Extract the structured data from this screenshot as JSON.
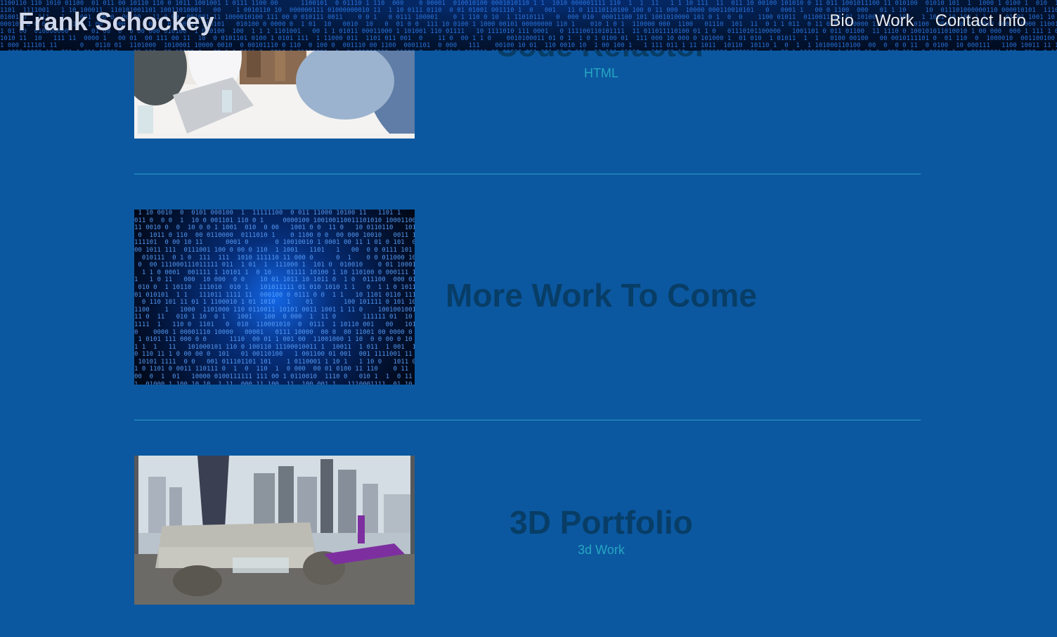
{
  "header": {
    "brand": "Frank Schockey",
    "nav": [
      "Bio",
      "Work",
      "Contact Info"
    ]
  },
  "work_items": [
    {
      "title": "Code Refactor",
      "subtitle": "HTML",
      "image": "team-meeting-photo"
    },
    {
      "title": "More Work To Come",
      "subtitle": "",
      "image": "binary-code-background"
    },
    {
      "title": "3D Portfolio",
      "subtitle": "3d Work",
      "image": "3d-living-room-render"
    }
  ],
  "colors": {
    "page_bg": "#0b58a0",
    "title": "#083d66",
    "subtitle": "#27a6c2",
    "divider": "#2aa0c8"
  }
}
